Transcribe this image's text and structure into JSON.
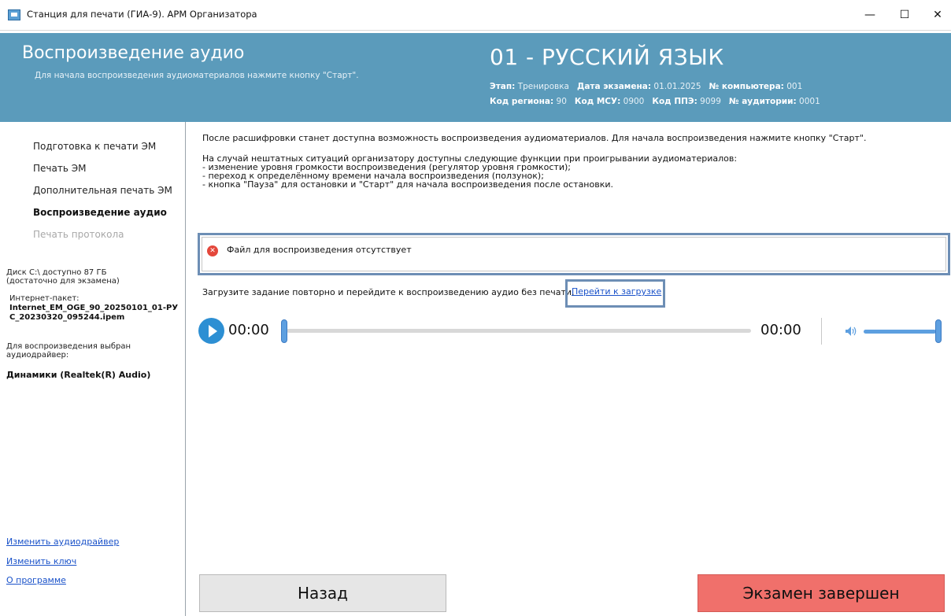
{
  "window": {
    "title": "Станция для печати (ГИА-9). АРМ Организатора",
    "minimize": "—",
    "maximize": "☐",
    "close": "✕"
  },
  "header": {
    "title": "Воспроизведение аудио",
    "subtitle": "Для начала воспроизведения аудиоматериалов нажмите кнопку \"Старт\".",
    "subject": "01 - РУССКИЙ ЯЗЫК",
    "stage_label": "Этап:",
    "stage_value": "Тренировка",
    "exam_date_label": "Дата экзамена:",
    "exam_date_value": "01.01.2025",
    "computer_label": "№ компьютера:",
    "computer_value": "001",
    "region_label": "Код региона:",
    "region_value": "90",
    "msu_label": "Код МСУ:",
    "msu_value": "0900",
    "ppe_label": "Код ППЭ:",
    "ppe_value": "9099",
    "room_label": "№ аудитории:",
    "room_value": "0001"
  },
  "sidebar": {
    "items": [
      {
        "label": "Подготовка к печати ЭМ"
      },
      {
        "label": "Печать ЭМ"
      },
      {
        "label": "Дополнительная печать ЭМ"
      },
      {
        "label": "Воспроизведение аудио"
      },
      {
        "label": "Печать протокола"
      }
    ],
    "disk_line1": "Диск C:\\ доступно 87 ГБ",
    "disk_line2": "(достаточно для экзамена)",
    "package_label": "Интернет-пакет:",
    "package_name": "Internet_EM_OGE_90_20250101_01-РУС_20230320_095244.ipem",
    "driver_line1": "Для воспроизведения выбран",
    "driver_line2": "аудиодрайвер:",
    "driver_name": "Динамики (Realtek(R) Audio)",
    "links": [
      {
        "label": "Изменить аудиодрайвер"
      },
      {
        "label": "Изменить ключ"
      },
      {
        "label": "О программе"
      }
    ]
  },
  "main": {
    "intro": "После расшифровки станет доступна возможность воспроизведения аудиоматериалов. Для начала воспроизведения нажмите кнопку \"Старт\".",
    "emergency_title": "На случай нештатных ситуаций организатору доступны следующие функции при проигрывании аудиоматериалов:",
    "emergency_items": [
      " - изменение уровня громкости воспроизведения (регулятор уровня громкости);",
      " - переход к определённому времени начала воспроизведения (ползунок);",
      " - кнопка \"Пауза\" для остановки и \"Старт\" для начала воспроизведения после остановки."
    ],
    "error_message": "Файл для воспроизведения отсутствует",
    "reload_text": "Загрузите задание повторно и перейдите к воспроизведению аудио без печати.",
    "goto_link": "Перейти к загрузке"
  },
  "player": {
    "current_time": "00:00",
    "total_time": "00:00",
    "progress_fraction": 0,
    "volume_fraction": 1.0
  },
  "buttons": {
    "back": "Назад",
    "finish": "Экзамен завершен"
  },
  "colors": {
    "header_bg": "#5b9bbb",
    "finish_bg": "#f0706b",
    "accent": "#2d8fd3",
    "link": "#1a52c9",
    "error": "#e4473b"
  }
}
